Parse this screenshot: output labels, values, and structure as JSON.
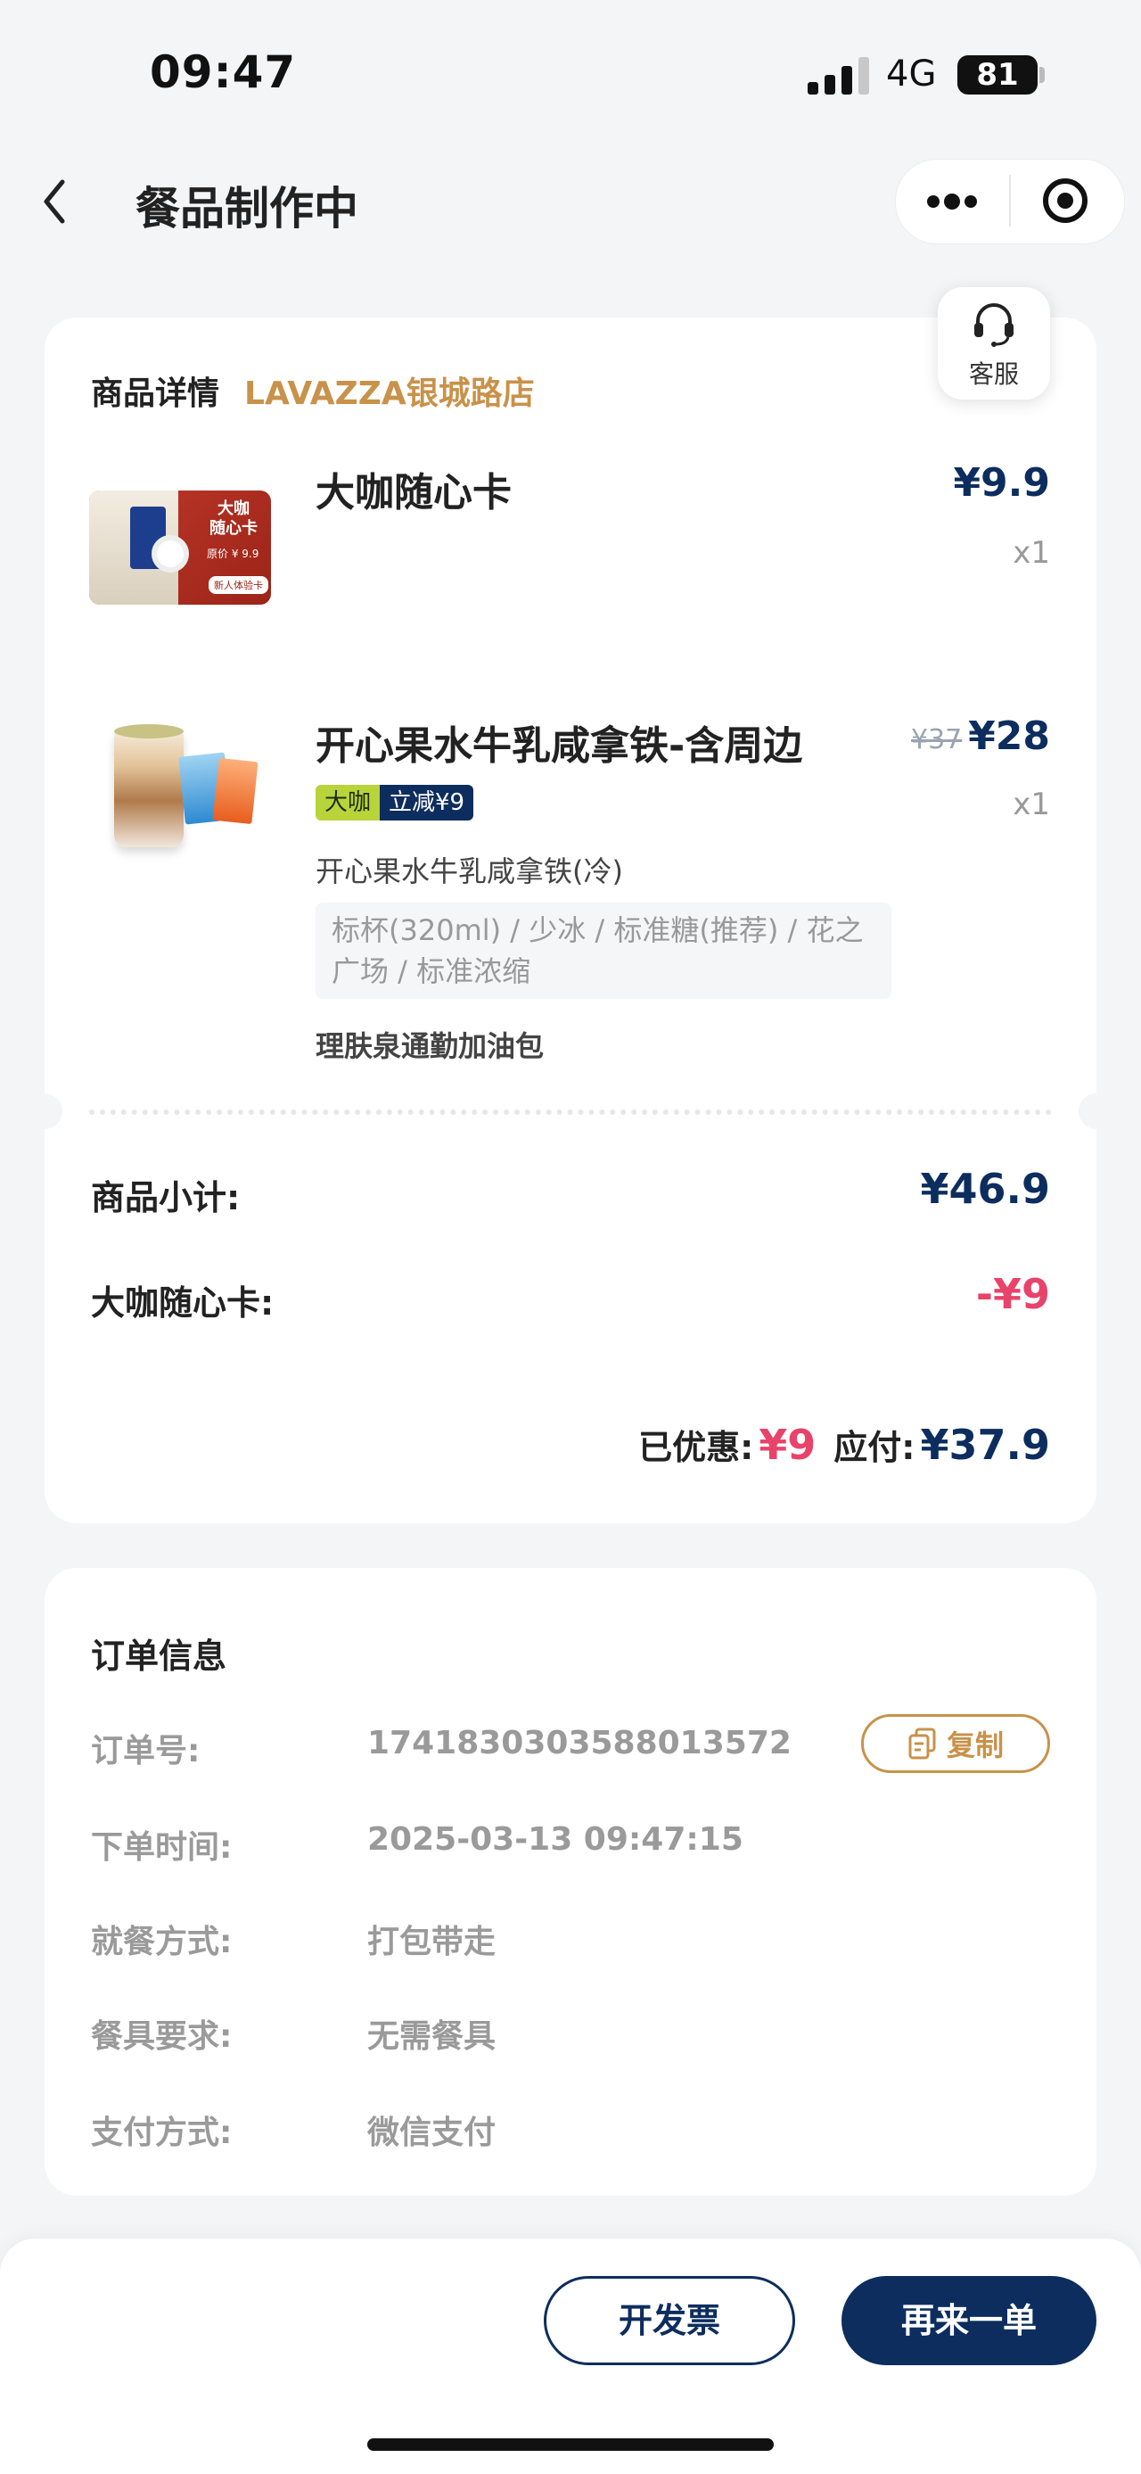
{
  "status_bar": {
    "time": "09:47",
    "network": "4G",
    "battery": "81"
  },
  "nav": {
    "title": "餐品制作中"
  },
  "customer_service": {
    "label": "客服"
  },
  "order_card": {
    "section_label": "商品详情",
    "store_name": "LAVAZZA银城路店",
    "items": [
      {
        "name": "大咖随心卡",
        "price": "¥9.9",
        "qty": "x1",
        "image_text": {
          "title": "大咖\n随心卡",
          "price_tag": "¥ 9.9",
          "footer": "新人体验卡"
        }
      },
      {
        "name": "开心果水牛乳咸拿铁-含周边",
        "original_price": "¥37",
        "price": "¥28",
        "qty": "x1",
        "badge": {
          "left": "大咖",
          "right": "立减¥9"
        },
        "variant": "开心果水牛乳咸拿铁(冷)",
        "specs": "标杯(320ml) / 少冰 / 标准糖(推荐) / 花之广场 / 标准浓缩",
        "gift": "理肤泉通勤加油包"
      }
    ],
    "subtotal_label": "商品小计:",
    "subtotal_value": "¥46.9",
    "card_discount_label": "大咖随心卡:",
    "card_discount_value": "-¥9",
    "saved_label": "已优惠:",
    "saved_value": "¥9",
    "payable_label": "应付:",
    "payable_value": "¥37.9"
  },
  "order_info": {
    "title": "订单信息",
    "copy_label": "复制",
    "rows": [
      {
        "label": "订单号:",
        "value": "1741830303588013572"
      },
      {
        "label": "下单时间:",
        "value": "2025-03-13 09:47:15"
      },
      {
        "label": "就餐方式:",
        "value": "打包带走"
      },
      {
        "label": "餐具要求:",
        "value": "无需餐具"
      },
      {
        "label": "支付方式:",
        "value": "微信支付"
      }
    ]
  },
  "actions": {
    "invoice": "开发票",
    "reorder": "再来一单"
  },
  "colors": {
    "brand_navy": "#0d2d5e",
    "gold": "#c8924a",
    "discount_red": "#e8436a",
    "badge_green": "#b8d43a"
  },
  "icons": [
    "back-arrow-icon",
    "more-dots-icon",
    "close-target-icon",
    "headset-icon",
    "copy-icon"
  ]
}
